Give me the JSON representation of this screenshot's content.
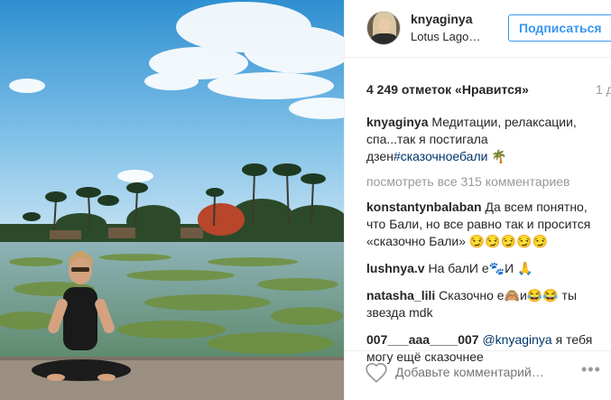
{
  "post": {
    "username": "knyaginya",
    "location": "Lotus Lago…",
    "follow_label": "Подписаться",
    "likes": "4 249 отметок «Нравится»",
    "time": "1 д",
    "caption": {
      "user": "knyaginya",
      "text": "Медитации, релаксации, спа...так я постигала дзен",
      "hashtag": "#сказочноебали",
      "emoji": "🌴"
    },
    "view_all": "посмотреть все 315 комментариев",
    "comments": [
      {
        "user": "konstantynbalaban",
        "text": "Да всем понятно, что Бали, но все равно так и просится «сказочно Бали» 😏😏😏😏😏"
      },
      {
        "user": "lushnya.v",
        "text": "На балИ е🐾И 🙏"
      },
      {
        "user": "natasha_lili",
        "text": "Сказочно е🙈и😂😂 ты звезда mdk"
      },
      {
        "user": "007___aaa____007",
        "mention": "@knyaginya",
        "text": "я тебя могу ещё сказочнее"
      }
    ],
    "add_comment_placeholder": "Добавьте комментарий…",
    "more_label": "•••"
  },
  "icons": {
    "heart": "heart-outline-icon",
    "more": "more-options-icon"
  },
  "colors": {
    "accent": "#3897f0",
    "link": "#003569",
    "muted": "#999999"
  }
}
